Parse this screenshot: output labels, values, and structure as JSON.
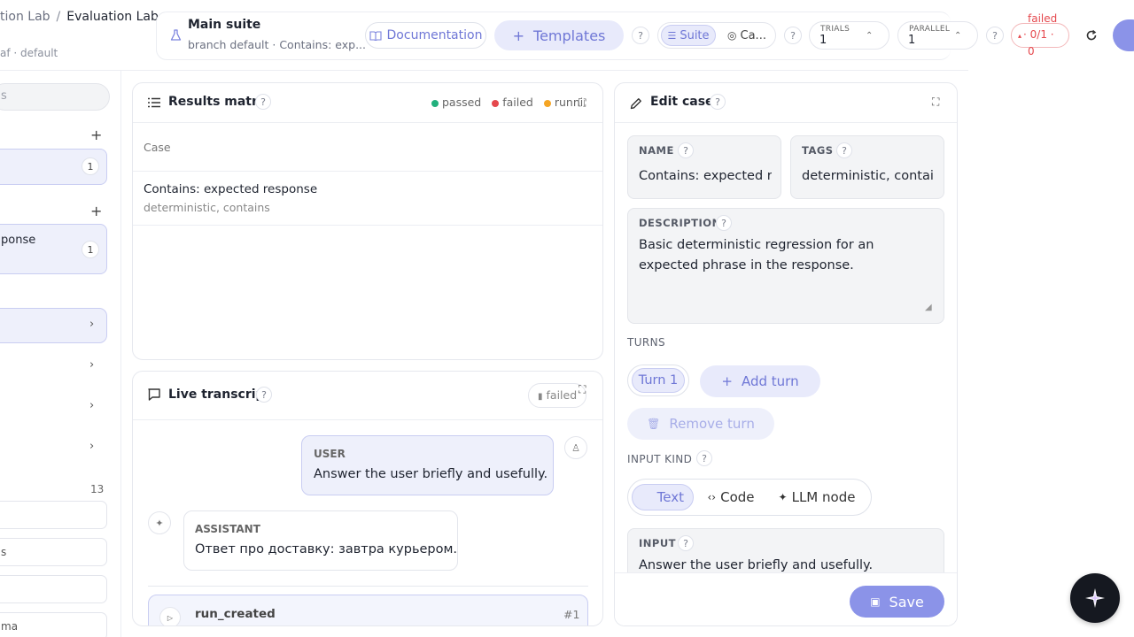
{
  "header": {
    "breadcrumb_parent": "tion Lab",
    "breadcrumb_separator": "/",
    "breadcrumb_current": "Evaluation Lab",
    "breadcrumb_sub": "af · default"
  },
  "suite": {
    "title": "Main suite",
    "subtitle": "branch default · Contains: exp..."
  },
  "toolbar": {
    "documentation_label": "Documentation",
    "templates_label": "Templates",
    "help": "?",
    "suite_toggle": "Suite",
    "case_toggle": "Ca...",
    "trials_label": "TRIALS",
    "trials_value": "1",
    "parallel_label": "PARALLEL",
    "parallel_value": "1",
    "status_label": "failed",
    "status_value": "· 0/1 ·",
    "status_count": "0"
  },
  "sidebar": {
    "search_placeholder": "s",
    "group1_count": "1",
    "group2_item": "ponse",
    "group2_count": "1",
    "section_count": "13",
    "items": [
      "s",
      "ma"
    ]
  },
  "results": {
    "title": "Results matrix",
    "legend": [
      "passed",
      "failed",
      "running"
    ],
    "legend_colors": [
      "#22b07d",
      "#e5484d",
      "#f5a524"
    ],
    "column_header": "Case",
    "rows": [
      {
        "name": "Contains: expected response",
        "tags": "deterministic, contains"
      }
    ]
  },
  "transcript": {
    "title": "Live transcript",
    "status": "failed",
    "user_role": "USER",
    "user_text": "Answer the user briefly and usefully.",
    "assistant_role": "ASSISTANT",
    "assistant_text": "Ответ про доставку: завтра курьером.",
    "event_name": "run_created",
    "event_index": "#1"
  },
  "edit": {
    "title": "Edit case",
    "name_label": "NAME",
    "name_value": "Contains: expected response",
    "tags_label": "TAGS",
    "tags_value": "deterministic, contains",
    "description_label": "DESCRIPTION",
    "description_value": "Basic deterministic regression for an expected phrase in the response.",
    "turns_label": "TURNS",
    "turn_1": "Turn 1",
    "add_turn": "Add turn",
    "remove_turn": "Remove turn",
    "input_kind_label": "INPUT KIND",
    "kinds": [
      "Text",
      "Code",
      "LLM node"
    ],
    "input_label": "INPUT",
    "input_value": "Answer the user briefly and usefully.",
    "save_label": "Save"
  },
  "colors": {
    "accent": "#8b93e8",
    "accent_soft": "#e8eafb",
    "failed": "#e5484d"
  }
}
